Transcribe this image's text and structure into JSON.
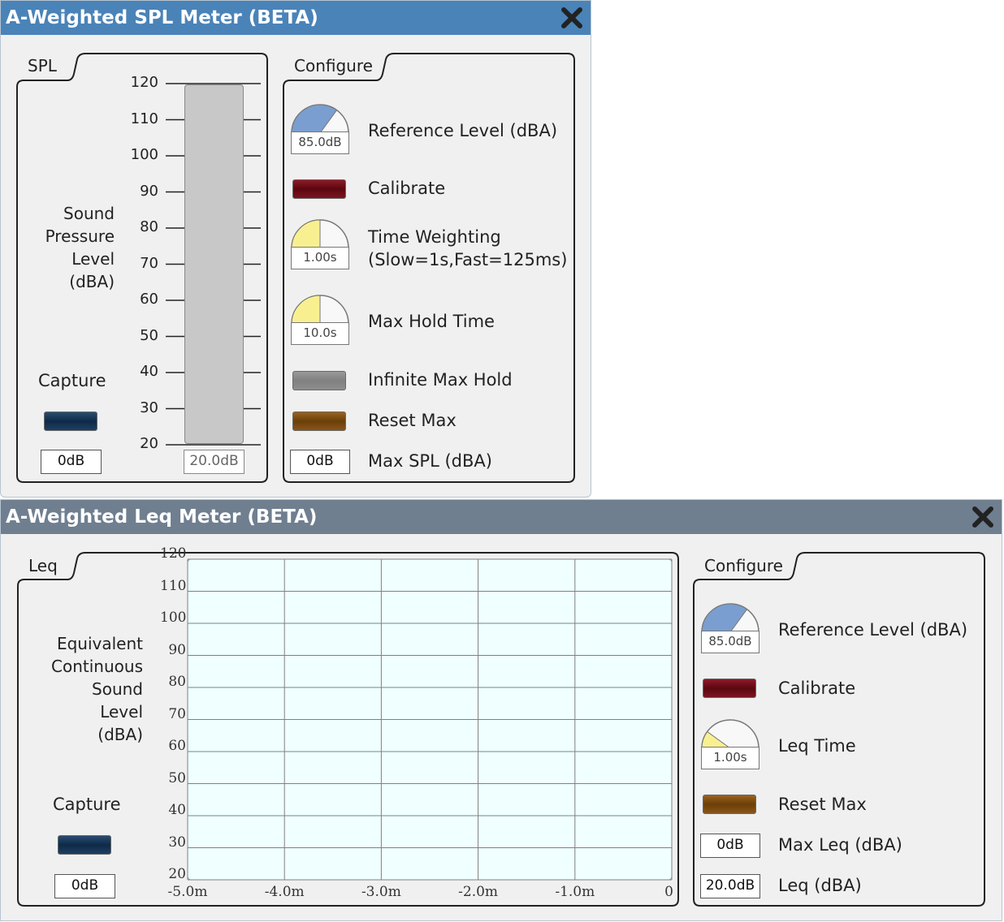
{
  "spl_window": {
    "title": "A-Weighted SPL Meter (BETA)",
    "close_icon": "close-x-icon",
    "titlebar_color": "#4a83b8",
    "spl_group": {
      "label": "SPL",
      "axis_label_lines": [
        "Sound",
        "Pressure",
        "Level",
        "(dBA)"
      ],
      "ticks": [
        "120",
        "110",
        "100",
        "90",
        "80",
        "70",
        "60",
        "50",
        "40",
        "30",
        "20"
      ],
      "bar_value": "20.0dB",
      "capture_label": "Capture",
      "capture_value": "0dB"
    },
    "configure_group": {
      "label": "Configure",
      "reference_level": {
        "label": "Reference Level (dBA)",
        "value": "85.0dB",
        "knob_fraction": 0.7
      },
      "calibrate": {
        "label": "Calibrate"
      },
      "time_weighting": {
        "label_line1": "Time Weighting",
        "label_line2": "(Slow=1s,Fast=125ms)",
        "value": "1.00s",
        "knob_fraction": 0.5
      },
      "max_hold_time": {
        "label": "Max Hold Time",
        "value": "10.0s",
        "knob_fraction": 0.5
      },
      "infinite_max_hold": {
        "label": "Infinite Max Hold"
      },
      "reset_max": {
        "label": "Reset Max"
      },
      "max_spl": {
        "label": "Max SPL (dBA)",
        "value": "0dB"
      }
    }
  },
  "leq_window": {
    "title": "A-Weighted Leq Meter (BETA)",
    "close_icon": "close-x-icon",
    "titlebar_color": "#6f7f90",
    "leq_group": {
      "label": "Leq",
      "axis_label_lines": [
        "Equivalent",
        "Continuous",
        "Sound",
        "Level",
        "(dBA)"
      ],
      "capture_label": "Capture",
      "capture_value": "0dB"
    },
    "configure_group": {
      "label": "Configure",
      "reference_level": {
        "label": "Reference Level (dBA)",
        "value": "85.0dB",
        "knob_fraction": 0.7
      },
      "calibrate": {
        "label": "Calibrate"
      },
      "leq_time": {
        "label": "Leq Time",
        "value": "1.00s",
        "knob_fraction": 0.2
      },
      "reset_max": {
        "label": "Reset Max"
      },
      "max_leq": {
        "label": "Max Leq (dBA)",
        "value": "0dB"
      },
      "leq": {
        "label": "Leq (dBA)",
        "value": "20.0dB"
      }
    }
  },
  "chart_data": {
    "type": "line",
    "x_ticks": [
      "-5.0m",
      "-4.0m",
      "-3.0m",
      "-2.0m",
      "-1.0m",
      "0"
    ],
    "y_ticks": [
      "120",
      "110",
      "100",
      "90",
      "80",
      "70",
      "60",
      "50",
      "40",
      "30",
      "20"
    ],
    "xlim": [
      -5.0,
      0
    ],
    "ylim": [
      20,
      120
    ],
    "grid": true,
    "series": [],
    "plot_background": "#f0ffff"
  }
}
